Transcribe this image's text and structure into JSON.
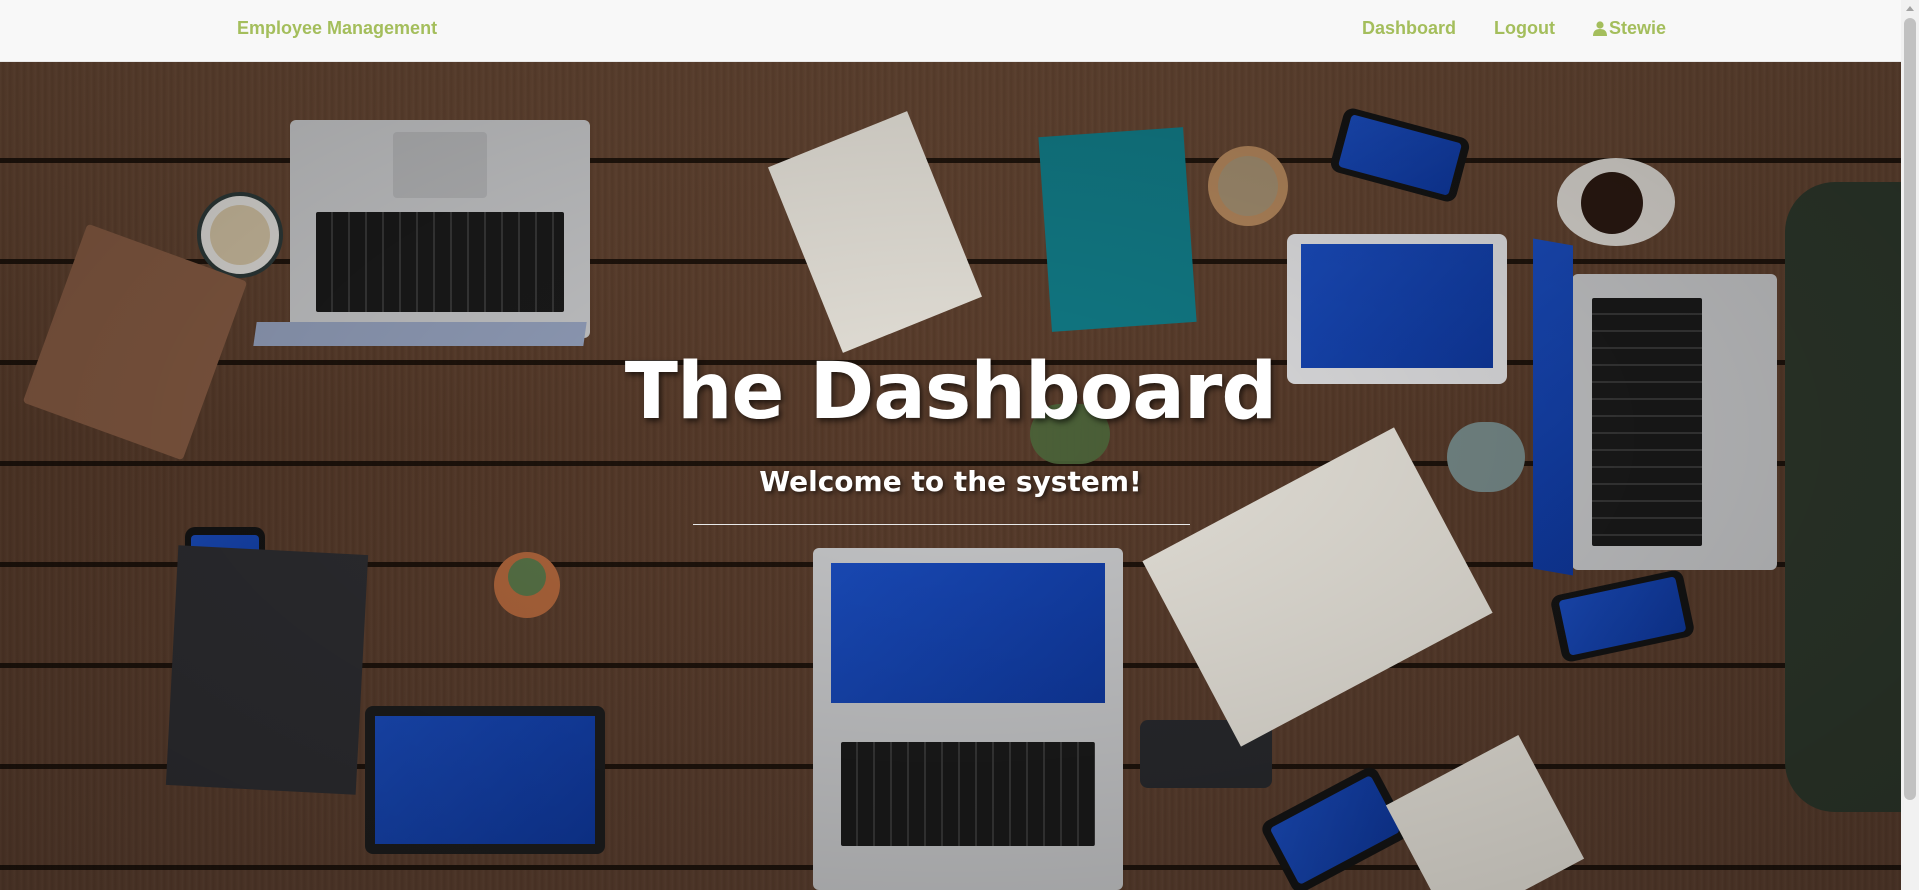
{
  "navbar": {
    "brand": "Employee Management",
    "links": [
      {
        "label": "Dashboard"
      },
      {
        "label": "Logout"
      },
      {
        "label": "Stewie",
        "icon": "user-icon"
      }
    ],
    "accent_color": "#a4be5c"
  },
  "hero": {
    "title": "The Dashboard",
    "subtitle": "Welcome to the system!",
    "background": "photo of a wooden meeting table with laptops, tablets, phones, notebooks and coffee mugs"
  }
}
